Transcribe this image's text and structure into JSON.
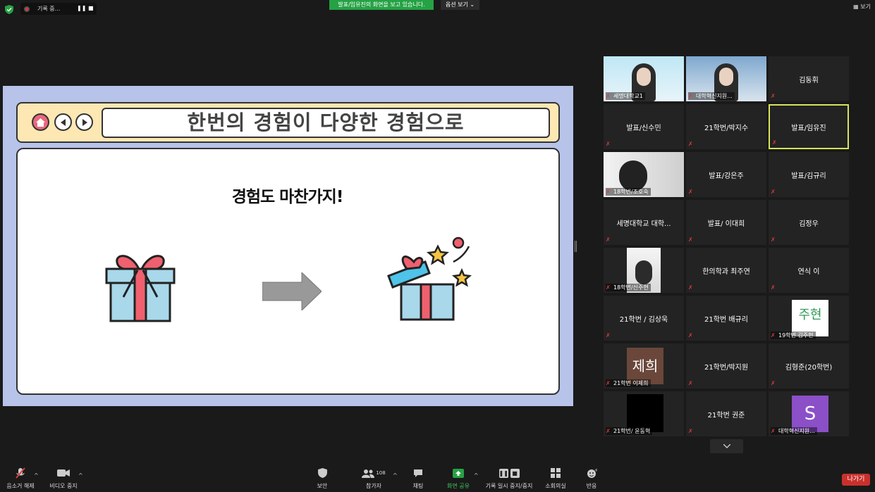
{
  "top": {
    "recording_label": "기록 중...",
    "share_banner": "발표/임유진의 화면을 보고 있습니다.",
    "view_options": "옵션 보기 ⌄",
    "view_label": "보기"
  },
  "slide": {
    "title": "한번의 경험이 다양한 경험으로",
    "subtitle": "경험도 마찬가지!"
  },
  "gallery": {
    "tiles": [
      {
        "label": "세명대학교1"
      },
      {
        "label": "대학혁신지원..."
      },
      {
        "name": "김동휘"
      },
      {
        "name": "발표/신수민"
      },
      {
        "name": "21학번/박지수"
      },
      {
        "name": "발표/임유진"
      },
      {
        "label": "18학번/조호숙"
      },
      {
        "name": "발표/강은주"
      },
      {
        "name": "발표/김규리"
      },
      {
        "name": "세명대학교 대학..."
      },
      {
        "name": "발표/ 이대희"
      },
      {
        "name": "김정우"
      },
      {
        "label": "18학번/신주현"
      },
      {
        "name": "한의학과 최주연"
      },
      {
        "name": "연식 이"
      },
      {
        "name": "21학번 / 김상욱"
      },
      {
        "name": "21학번 배규리"
      },
      {
        "label": "19학번 김주현",
        "handwriting": "주현"
      },
      {
        "label": "21학번 이제희",
        "avatar": "제희"
      },
      {
        "name": "21학번/박지원"
      },
      {
        "name": "김형준(20학번)"
      },
      {
        "label": "21학번/ 윤동혁"
      },
      {
        "name": "21학번 권준"
      },
      {
        "label": "대학혁신지원...",
        "avatar": "S"
      }
    ]
  },
  "toolbar": {
    "mute": "음소거 해제",
    "video": "비디오 중지",
    "security": "보안",
    "participants": "참가자",
    "participant_count": "108",
    "chat": "채팅",
    "share": "화면 공유",
    "pause_record": "기록 일시 중지/중지",
    "breakout": "소회의실",
    "reactions": "반응",
    "leave": "나가기"
  },
  "colors": {
    "share_green": "#25a244",
    "slide_bg": "#b7c3e8",
    "header_bg": "#fde7b3",
    "active_speaker": "#d9e35a",
    "leave_red": "#c9302c"
  }
}
